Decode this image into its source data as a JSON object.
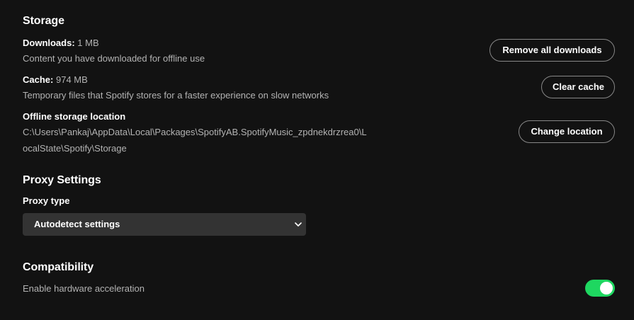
{
  "storage": {
    "title": "Storage",
    "downloads": {
      "label": "Downloads:",
      "value": "1 MB",
      "description": "Content you have downloaded for offline use",
      "button": "Remove all downloads"
    },
    "cache": {
      "label": "Cache:",
      "value": "974 MB",
      "description": "Temporary files that Spotify stores for a faster experience on slow networks",
      "button": "Clear cache"
    },
    "offline_location": {
      "label": "Offline storage location",
      "path_line1": "C:\\Users\\Pankaj\\AppData\\Local\\Packages\\SpotifyAB.SpotifyMusic_zpdnekdrzrea0\\L",
      "path_line2": "ocalState\\Spotify\\Storage",
      "button": "Change location"
    }
  },
  "proxy": {
    "title": "Proxy Settings",
    "type_label": "Proxy type",
    "selected": "Autodetect settings"
  },
  "compatibility": {
    "title": "Compatibility",
    "hardware_acceleration_label": "Enable hardware acceleration",
    "hardware_acceleration_enabled": true
  },
  "colors": {
    "background": "#121212",
    "accent": "#1ed760"
  },
  "icons": {
    "select_chevron": "chevron-down-icon"
  }
}
